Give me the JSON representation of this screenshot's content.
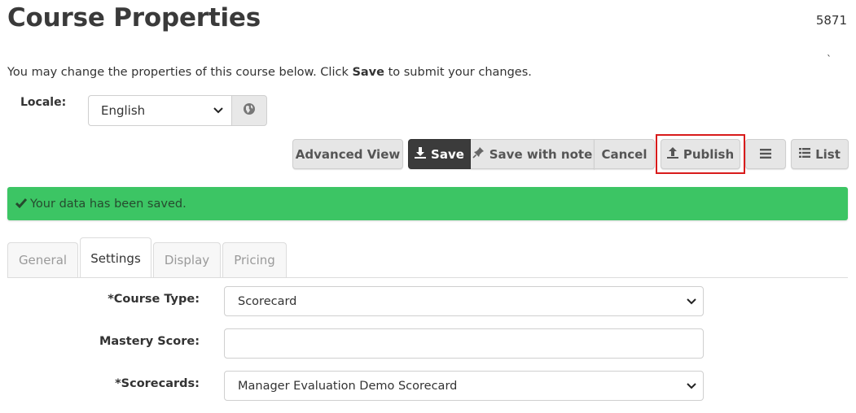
{
  "page": {
    "title": "Course Properties",
    "record_id": "5871",
    "corner_mark": "`",
    "intro_before": "You may change the properties of this course below. Click ",
    "intro_bold": "Save",
    "intro_after": " to submit your changes."
  },
  "locale": {
    "label": "Locale:",
    "selected": "English",
    "globe_icon": "globe-icon"
  },
  "toolbar": {
    "advanced_view": "Advanced View",
    "save": "Save",
    "save_with_note": "Save with note",
    "cancel": "Cancel",
    "publish": "Publish",
    "list": "List",
    "highlight_color": "#d81b1b"
  },
  "alert": {
    "message": "Your data has been saved.",
    "color": "#3cc564"
  },
  "tabs": [
    {
      "label": "General",
      "active": false
    },
    {
      "label": "Settings",
      "active": true
    },
    {
      "label": "Display",
      "active": false
    },
    {
      "label": "Pricing",
      "active": false
    }
  ],
  "fields": {
    "course_type": {
      "label": "*Course Type:",
      "value": "Scorecard"
    },
    "mastery_score": {
      "label": "Mastery Score:",
      "value": ""
    },
    "scorecards": {
      "label": "*Scorecards:",
      "value": "Manager Evaluation Demo Scorecard"
    }
  }
}
